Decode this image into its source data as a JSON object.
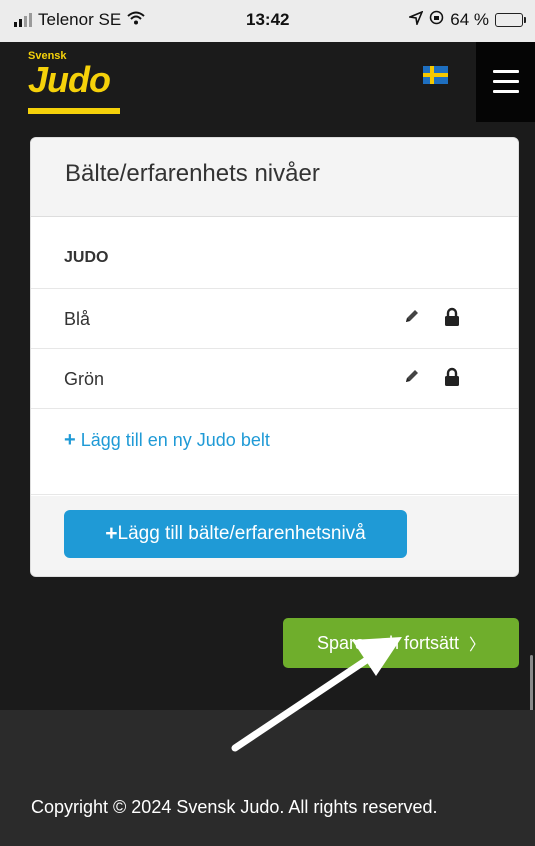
{
  "status_bar": {
    "carrier": "Telenor SE",
    "time": "13:42",
    "battery": "64 %",
    "battery_level": 0.64
  },
  "header": {
    "logo_top": "Svensk",
    "logo_word": "Judo",
    "flag_icon": "swedish-flag-icon",
    "menu_icon": "hamburger-menu-icon"
  },
  "card": {
    "title": "Bälte/erfarenhets nivåer",
    "section_title": "JUDO",
    "rows": [
      {
        "label": "Blå"
      },
      {
        "label": "Grön"
      }
    ],
    "add_link": "Lägg till en ny Judo belt",
    "add_button": "Lägg till bälte/erfarenhetsnivå"
  },
  "save_button": {
    "label": "Spara och fortsätt",
    "chevron": "〉"
  },
  "footer": {
    "copyright": "Copyright © 2024 Svensk Judo. All rights reserved."
  },
  "colors": {
    "accent_blue": "#1f9ad6",
    "save_green": "#6fae2c",
    "brand_yellow": "#f5d10a",
    "header_dark": "#1b1b1b"
  }
}
